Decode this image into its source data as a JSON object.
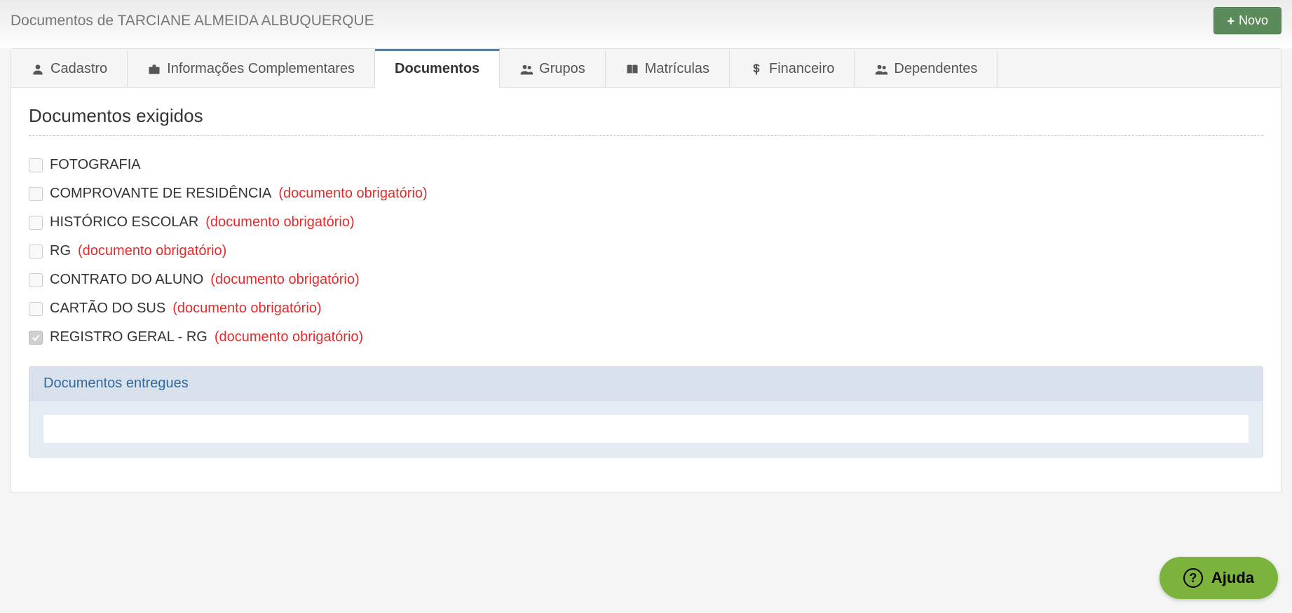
{
  "page_title": "Documentos de TARCIANE ALMEIDA ALBUQUERQUE",
  "new_button": "Novo",
  "tabs": [
    {
      "label": "Cadastro",
      "icon": "user-icon",
      "active": false
    },
    {
      "label": "Informações Complementares",
      "icon": "briefcase-icon",
      "active": false
    },
    {
      "label": "Documentos",
      "icon": null,
      "active": true
    },
    {
      "label": "Grupos",
      "icon": "users-icon",
      "active": false
    },
    {
      "label": "Matrículas",
      "icon": "book-icon",
      "active": false
    },
    {
      "label": "Financeiro",
      "icon": "dollar-icon",
      "active": false
    },
    {
      "label": "Dependentes",
      "icon": "users-icon",
      "active": false
    }
  ],
  "section_title": "Documentos exigidos",
  "required_tag": "(documento obrigatório)",
  "documents": [
    {
      "name": "FOTOGRAFIA",
      "required": false,
      "checked": false
    },
    {
      "name": "COMPROVANTE DE RESIDÊNCIA",
      "required": true,
      "checked": false
    },
    {
      "name": "HISTÓRICO ESCOLAR",
      "required": true,
      "checked": false
    },
    {
      "name": "RG",
      "required": true,
      "checked": false
    },
    {
      "name": "CONTRATO DO ALUNO",
      "required": true,
      "checked": false
    },
    {
      "name": "CARTÃO DO SUS",
      "required": true,
      "checked": false
    },
    {
      "name": "REGISTRO GERAL - RG",
      "required": true,
      "checked": true
    }
  ],
  "delivered_panel_title": "Documentos entregues",
  "help_label": "Ajuda"
}
